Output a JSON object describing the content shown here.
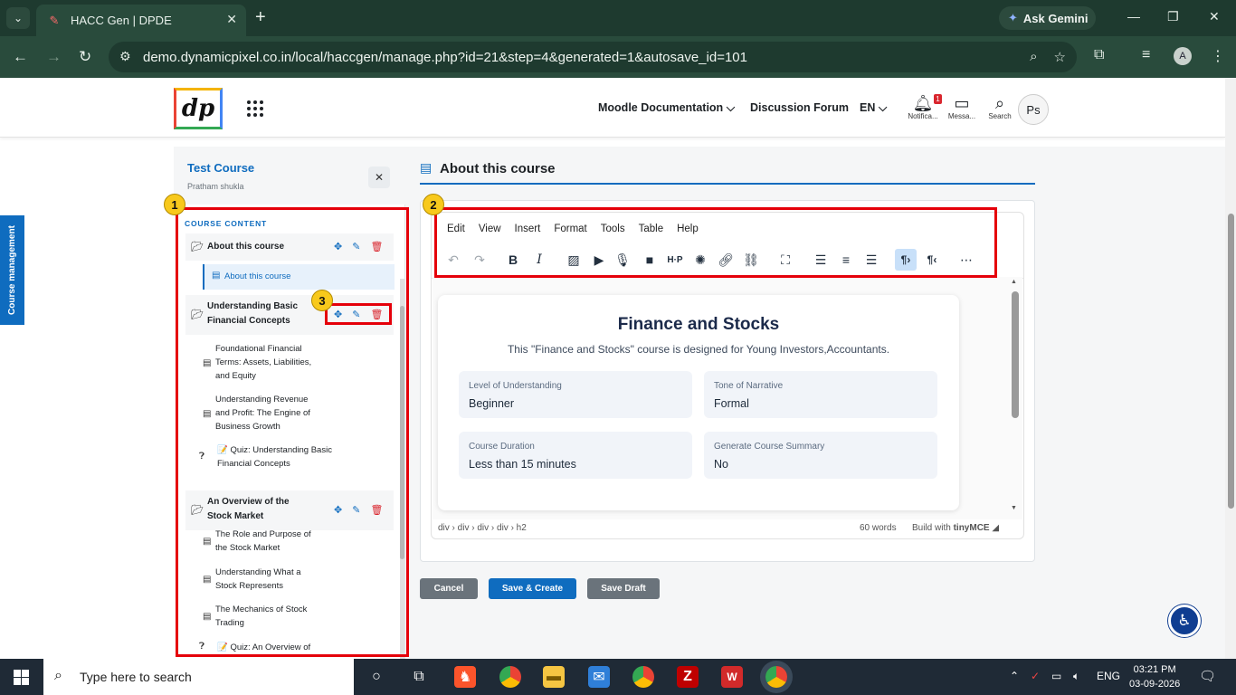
{
  "browser": {
    "tab_title": "HACC Gen | DPDE",
    "gemini_label": "Ask Gemini",
    "url": "demo.dynamicpixel.co.in/local/haccgen/manage.php?id=21&step=4&generated=1&autosave_id=101",
    "profile_initial": "A"
  },
  "topnav": {
    "logo_text": "dp",
    "links": [
      "Moodle Documentation",
      "Discussion Forum",
      "EN"
    ],
    "notifications_label": "Notifica...",
    "notifications_count": "1",
    "messages_label": "Messa...",
    "search_label": "Search",
    "user_initials": "Ps"
  },
  "side_tab": {
    "label": "Course management"
  },
  "drawer": {
    "course_title": "Test Course",
    "author": "Pratham shukla",
    "content_label": "COURSE CONTENT",
    "sections": [
      {
        "name": "About this course",
        "activities": [
          {
            "name": "About this course",
            "type": "page",
            "active": true
          }
        ]
      },
      {
        "name": "Understanding Basic Financial Concepts",
        "activities": [
          {
            "name": "Foundational Financial Terms: Assets, Liabilities, and Equity",
            "type": "page"
          },
          {
            "name": "Understanding Revenue and Profit: The Engine of Business Growth",
            "type": "page"
          },
          {
            "name": "📝 Quiz: Understanding Basic Financial Concepts",
            "type": "quiz"
          }
        ]
      },
      {
        "name": "An Overview of the Stock Market",
        "activities": [
          {
            "name": "The Role and Purpose of the Stock Market",
            "type": "page"
          },
          {
            "name": "Understanding What a Stock Represents",
            "type": "page"
          },
          {
            "name": "The Mechanics of Stock Trading",
            "type": "page"
          },
          {
            "name": "📝 Quiz: An Overview of",
            "type": "quiz"
          }
        ]
      }
    ]
  },
  "main": {
    "heading": "About this course",
    "editor": {
      "menus": [
        "Edit",
        "View",
        "Insert",
        "Format",
        "Tools",
        "Table",
        "Help"
      ],
      "toolbar_icons": [
        "undo-icon",
        "redo-icon",
        "bold-icon",
        "italic-icon",
        "image-icon",
        "media-icon",
        "microphone-icon",
        "video-icon",
        "h5p-icon",
        "ai-icon",
        "link-icon",
        "unlink-icon",
        "fullscreen-icon",
        "align-left-icon",
        "align-center-icon",
        "align-right-icon",
        "ltr-icon",
        "rtl-icon",
        "more-icon"
      ],
      "path": "div › div › div › div › h2",
      "word_count": "60 words",
      "built_with": "Build with",
      "brand": "tinyMCE"
    },
    "summary": {
      "title": "Finance and Stocks",
      "subtitle": "This \"Finance and Stocks\" course is designed for Young Investors,Accountants.",
      "fields": [
        {
          "label": "Level of Understanding",
          "value": "Beginner"
        },
        {
          "label": "Tone of Narrative",
          "value": "Formal"
        },
        {
          "label": "Course Duration",
          "value": "Less than 15 minutes"
        },
        {
          "label": "Generate Course Summary",
          "value": "No"
        }
      ]
    },
    "buttons": {
      "cancel": "Cancel",
      "save_create": "Save & Create",
      "save_draft": "Save Draft"
    }
  },
  "annotations": [
    "1",
    "2",
    "3"
  ],
  "taskbar": {
    "search_placeholder": "Type here to search",
    "language": "ENG",
    "time": "03:21 PM",
    "date": "03-09-2026"
  },
  "colors": {
    "accent": "#0f6cbf",
    "danger": "#d9262e",
    "annotation": "#e5000a"
  }
}
